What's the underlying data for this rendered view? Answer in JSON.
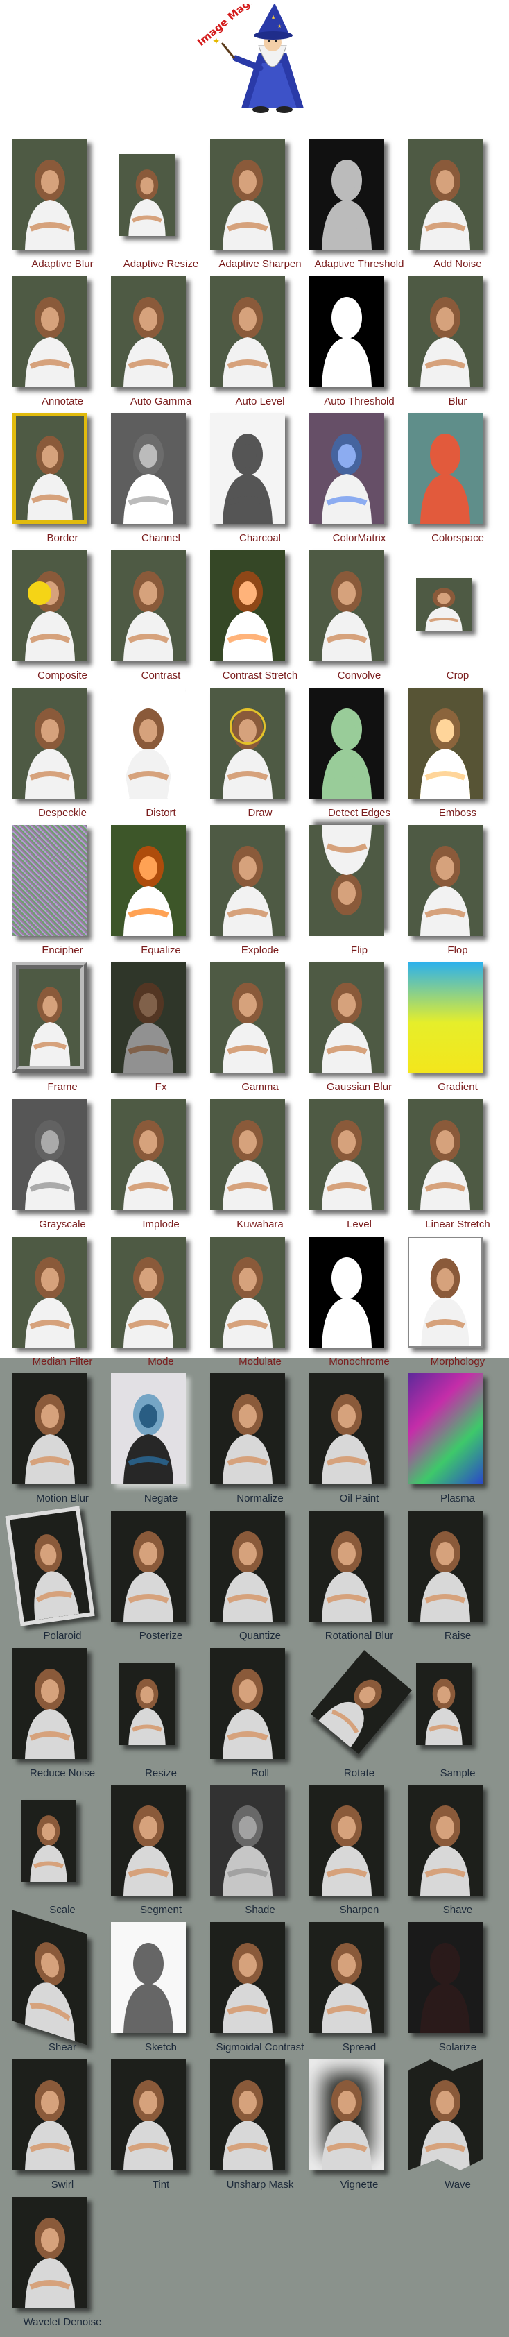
{
  "logo": {
    "text": "Image Magick"
  },
  "effects": [
    {
      "label": "Adaptive Blur",
      "icon": "photo-thumb"
    },
    {
      "label": "Adaptive Resize",
      "icon": "photo-thumb"
    },
    {
      "label": "Adaptive Sharpen",
      "icon": "photo-thumb"
    },
    {
      "label": "Adaptive Threshold",
      "icon": "photo-thumb"
    },
    {
      "label": "Add Noise",
      "icon": "photo-thumb"
    },
    {
      "label": "Annotate",
      "icon": "photo-thumb"
    },
    {
      "label": "Auto Gamma",
      "icon": "photo-thumb"
    },
    {
      "label": "Auto Level",
      "icon": "photo-thumb"
    },
    {
      "label": "Auto Threshold",
      "icon": "photo-thumb"
    },
    {
      "label": "Blur",
      "icon": "photo-thumb"
    },
    {
      "label": "Border",
      "icon": "photo-thumb"
    },
    {
      "label": "Channel",
      "icon": "photo-thumb"
    },
    {
      "label": "Charcoal",
      "icon": "photo-thumb"
    },
    {
      "label": "ColorMatrix",
      "icon": "photo-thumb"
    },
    {
      "label": "Colorspace",
      "icon": "photo-thumb"
    },
    {
      "label": "Composite",
      "icon": "photo-thumb"
    },
    {
      "label": "Contrast",
      "icon": "photo-thumb"
    },
    {
      "label": "Contrast Stretch",
      "icon": "photo-thumb"
    },
    {
      "label": "Convolve",
      "icon": "photo-thumb"
    },
    {
      "label": "Crop",
      "icon": "photo-thumb"
    },
    {
      "label": "Despeckle",
      "icon": "photo-thumb"
    },
    {
      "label": "Distort",
      "icon": "photo-thumb"
    },
    {
      "label": "Draw",
      "icon": "photo-thumb"
    },
    {
      "label": "Detect Edges",
      "icon": "photo-thumb"
    },
    {
      "label": "Emboss",
      "icon": "photo-thumb"
    },
    {
      "label": "Encipher",
      "icon": "photo-thumb"
    },
    {
      "label": "Equalize",
      "icon": "photo-thumb"
    },
    {
      "label": "Explode",
      "icon": "photo-thumb"
    },
    {
      "label": "Flip",
      "icon": "photo-thumb"
    },
    {
      "label": "Flop",
      "icon": "photo-thumb"
    },
    {
      "label": "Frame",
      "icon": "photo-thumb"
    },
    {
      "label": "Fx",
      "icon": "photo-thumb"
    },
    {
      "label": "Gamma",
      "icon": "photo-thumb"
    },
    {
      "label": "Gaussian Blur",
      "icon": "photo-thumb"
    },
    {
      "label": "Gradient",
      "icon": "photo-thumb"
    },
    {
      "label": "Grayscale",
      "icon": "photo-thumb"
    },
    {
      "label": "Implode",
      "icon": "photo-thumb"
    },
    {
      "label": "Kuwahara",
      "icon": "photo-thumb"
    },
    {
      "label": "Level",
      "icon": "photo-thumb"
    },
    {
      "label": "Linear Stretch",
      "icon": "photo-thumb"
    },
    {
      "label": "Median Filter",
      "icon": "photo-thumb"
    },
    {
      "label": "Mode",
      "icon": "photo-thumb"
    },
    {
      "label": "Modulate",
      "icon": "photo-thumb"
    },
    {
      "label": "Monochrome",
      "icon": "photo-thumb"
    },
    {
      "label": "Morphology",
      "icon": "photo-thumb"
    },
    {
      "label": "Motion Blur",
      "icon": "photo-thumb"
    },
    {
      "label": "Negate",
      "icon": "photo-thumb"
    },
    {
      "label": "Normalize",
      "icon": "photo-thumb"
    },
    {
      "label": "Oil Paint",
      "icon": "photo-thumb"
    },
    {
      "label": "Plasma",
      "icon": "photo-thumb"
    },
    {
      "label": "Polaroid",
      "icon": "photo-thumb"
    },
    {
      "label": "Posterize",
      "icon": "photo-thumb"
    },
    {
      "label": "Quantize",
      "icon": "photo-thumb"
    },
    {
      "label": "Rotational Blur",
      "icon": "photo-thumb"
    },
    {
      "label": "Raise",
      "icon": "photo-thumb"
    },
    {
      "label": "Reduce Noise",
      "icon": "photo-thumb"
    },
    {
      "label": "Resize",
      "icon": "photo-thumb"
    },
    {
      "label": "Roll",
      "icon": "photo-thumb"
    },
    {
      "label": "Rotate",
      "icon": "photo-thumb"
    },
    {
      "label": "Sample",
      "icon": "photo-thumb"
    },
    {
      "label": "Scale",
      "icon": "photo-thumb"
    },
    {
      "label": "Segment",
      "icon": "photo-thumb"
    },
    {
      "label": "Shade",
      "icon": "photo-thumb"
    },
    {
      "label": "Sharpen",
      "icon": "photo-thumb"
    },
    {
      "label": "Shave",
      "icon": "photo-thumb"
    },
    {
      "label": "Shear",
      "icon": "photo-thumb"
    },
    {
      "label": "Sketch",
      "icon": "photo-thumb"
    },
    {
      "label": "Sigmoidal Contrast",
      "icon": "photo-thumb"
    },
    {
      "label": "Spread",
      "icon": "photo-thumb"
    },
    {
      "label": "Solarize",
      "icon": "photo-thumb"
    },
    {
      "label": "Swirl",
      "icon": "photo-thumb"
    },
    {
      "label": "Tint",
      "icon": "photo-thumb"
    },
    {
      "label": "Unsharp Mask",
      "icon": "photo-thumb"
    },
    {
      "label": "Vignette",
      "icon": "photo-thumb"
    },
    {
      "label": "Wave",
      "icon": "photo-thumb"
    },
    {
      "label": "Wavelet Denoise",
      "icon": "photo-thumb"
    }
  ],
  "colors": {
    "page_bg": "#ffffff",
    "dark_section_bg": "#8a928c",
    "label_light": "#7a1d1d",
    "label_dark": "#1d2a3a"
  }
}
